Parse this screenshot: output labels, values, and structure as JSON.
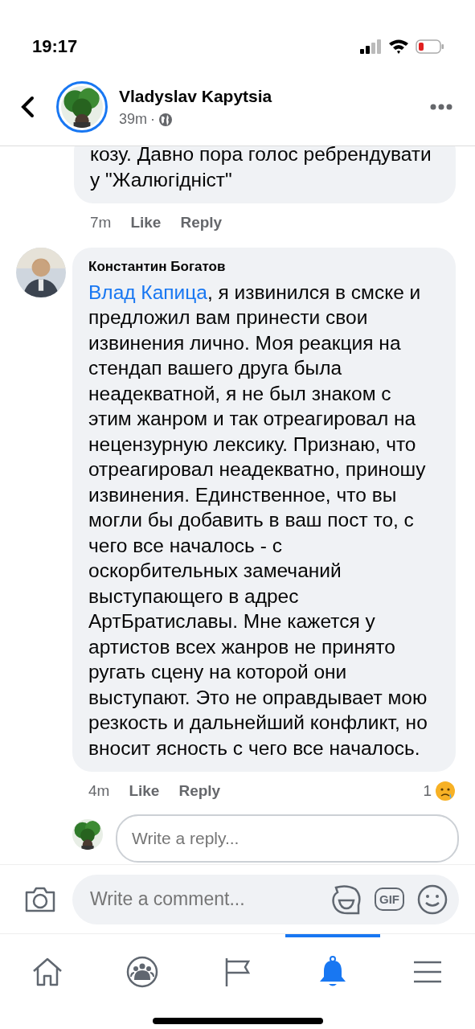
{
  "status_bar": {
    "time": "19:17"
  },
  "header": {
    "author": "Vladyslav Kapytsia",
    "time": "39m",
    "separator": "·"
  },
  "comments": [
    {
      "text": "козу. Давно пора голос ребрендувати у \"Жалюгідніст\"",
      "time": "7m",
      "like": "Like",
      "reply": "Reply"
    },
    {
      "author": "Константин Богатов",
      "mention": "Влад Капица",
      "text": ", я извинился в смске и предложил вам принести свои извинения лично. Моя реакция на стендап вашего друга была неадекватной, я не был знаком с этим жанром и так отреагировал на нецензурную лексику. Признаю, что отреагировал неадекватно, приношу извинения. Единственное, что вы могли бы добавить в ваш пост то, с чего все началось - с оскорбительных замечаний выступающего в адрес АртБратиславы. Мне кажется у артистов всех жанров не принято ругать сцену на которой они выступают. Это не оправдывает мою резкость и дальнейший конфликт, но вносит ясность с чего все началось.",
      "time": "4m",
      "like": "Like",
      "reply": "Reply",
      "reaction_count": "1"
    }
  ],
  "reply_field": {
    "placeholder": "Write a reply..."
  },
  "composer": {
    "placeholder": "Write a comment...",
    "gif": "GIF"
  },
  "tabs": [
    {
      "kind": "home",
      "selected": false
    },
    {
      "kind": "groups",
      "selected": false
    },
    {
      "kind": "pages",
      "selected": false
    },
    {
      "kind": "notifications",
      "selected": true
    },
    {
      "kind": "menu",
      "selected": false
    }
  ]
}
